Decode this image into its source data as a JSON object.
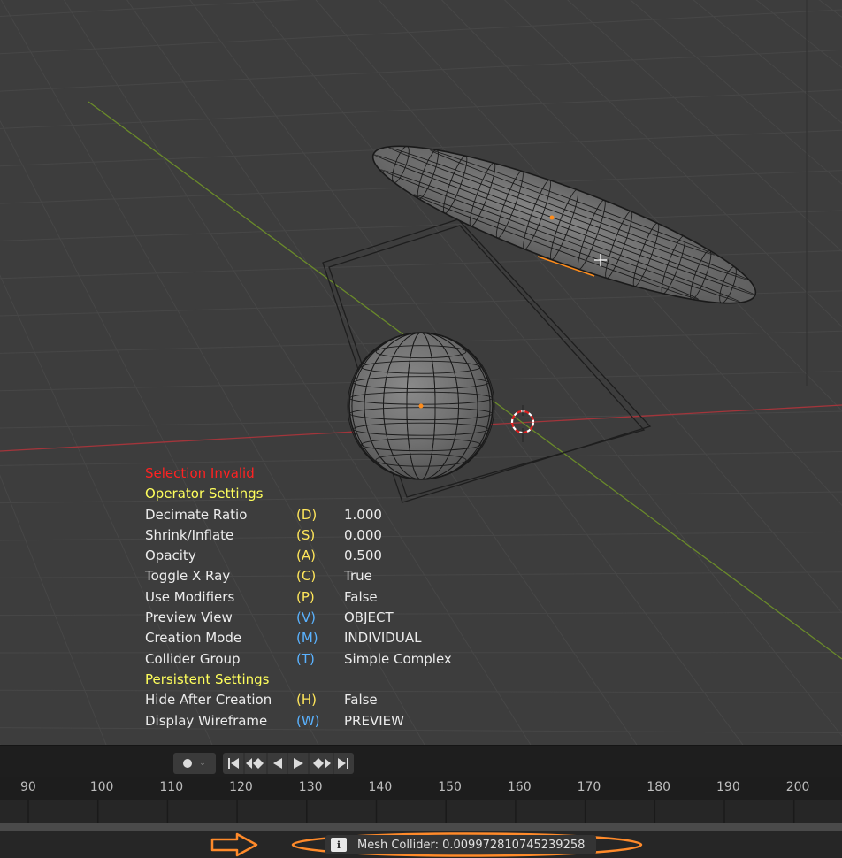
{
  "overlay": {
    "status": "Selection Invalid",
    "operator_header": "Operator Settings",
    "operator_rows": [
      {
        "label": "Decimate Ratio",
        "key": "(D)",
        "value": "1.000",
        "key_color": "yellow"
      },
      {
        "label": "Shrink/Inflate",
        "key": "(S)",
        "value": "0.000",
        "key_color": "yellow"
      },
      {
        "label": "Opacity",
        "key": "(A)",
        "value": "0.500",
        "key_color": "yellow"
      },
      {
        "label": "Toggle X Ray",
        "key": "(C)",
        "value": "True",
        "key_color": "yellow"
      },
      {
        "label": "Use Modifiers",
        "key": "(P)",
        "value": "False",
        "key_color": "yellow"
      },
      {
        "label": "Preview View",
        "key": "(V)",
        "value": "OBJECT",
        "key_color": "blue"
      },
      {
        "label": "Creation Mode",
        "key": "(M)",
        "value": "INDIVIDUAL",
        "key_color": "blue"
      },
      {
        "label": "Collider Group",
        "key": "(T)",
        "value": "Simple Complex",
        "key_color": "blue"
      }
    ],
    "persistent_header": "Persistent Settings",
    "persistent_rows": [
      {
        "label": "Hide After Creation",
        "key": "(H)",
        "value": "False",
        "key_color": "yellow"
      },
      {
        "label": "Display Wireframe",
        "key": "(W)",
        "value": "PREVIEW",
        "key_color": "blue"
      }
    ]
  },
  "timeline": {
    "frame_labels": [
      "90",
      "100",
      "110",
      "120",
      "130",
      "140",
      "150",
      "160",
      "170",
      "180",
      "190",
      "200"
    ],
    "playback_icons": [
      "record-icon",
      "dropdown-chevron-icon",
      "jump-start-icon",
      "prev-keyframe-icon",
      "play-reverse-icon",
      "play-icon",
      "next-keyframe-icon",
      "jump-end-icon"
    ]
  },
  "statusbar": {
    "message": "Mesh Collider: 0.009972810745239258",
    "icon": "info-icon",
    "icon_glyph": "i"
  },
  "colors": {
    "viewport_bg": "#3d3d3d",
    "x_axis": "#a3353b",
    "y_axis": "#6a8a2a",
    "annotation_orange": "#ff8a2a",
    "selected_orange": "#ff8c1a"
  }
}
